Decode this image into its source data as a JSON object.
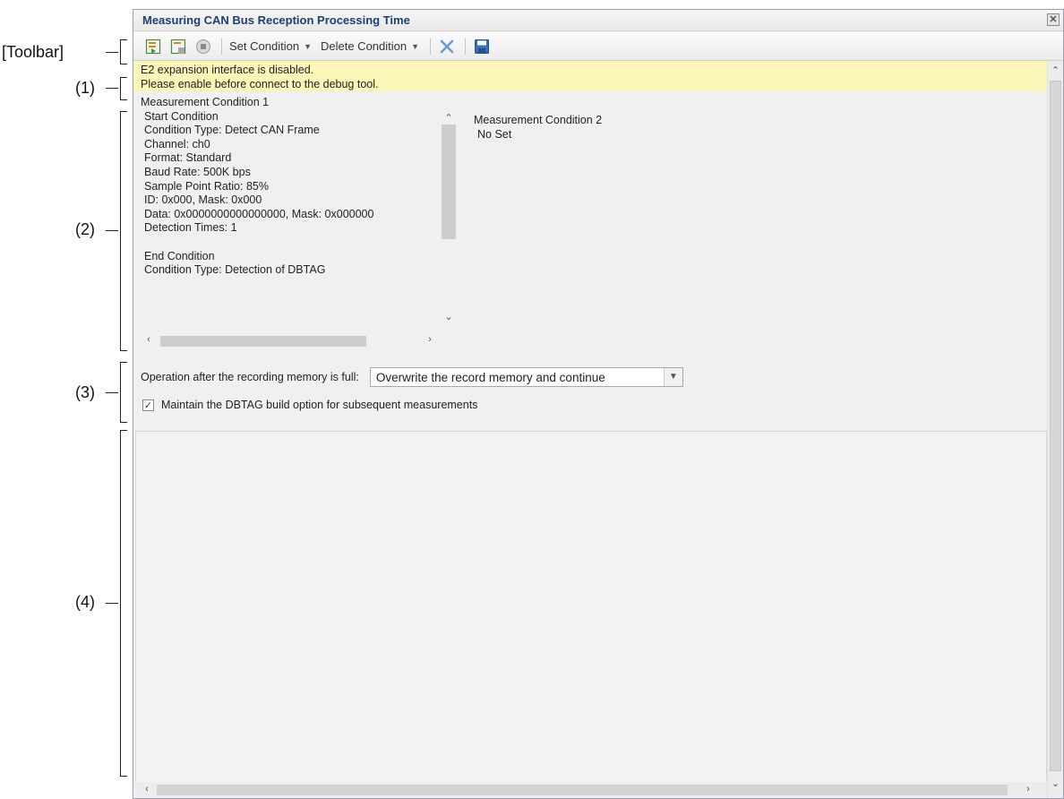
{
  "callouts": {
    "toolbar": "[Toolbar]",
    "c1": "(1)",
    "c2": "(2)",
    "c3": "(3)",
    "c4": "(4)"
  },
  "window": {
    "title": "Measuring CAN Bus Reception Processing Time",
    "close_glyph": "✕"
  },
  "toolbar": {
    "set_condition": "Set Condition",
    "delete_condition": "Delete Condition"
  },
  "warning": {
    "line1": "E2 expansion interface is disabled.",
    "line2": "Please enable before  connect to the debug tool."
  },
  "condition1": {
    "lines": [
      "Measurement Condition 1",
      "Start Condition",
      "Condition Type: Detect CAN Frame",
      "Channel: ch0",
      "Format: Standard",
      "Baud Rate: 500K bps",
      "Sample Point Ratio: 85%",
      "ID: 0x000, Mask: 0x000",
      "Data: 0x0000000000000000, Mask: 0x000000",
      "Detection Times: 1",
      "",
      "End Condition",
      "Condition Type: Detection of DBTAG"
    ]
  },
  "condition2": {
    "title": "Measurement Condition 2",
    "value": "No Set"
  },
  "options": {
    "label": "Operation after the recording memory is full:",
    "selected": "Overwrite the record memory and continue",
    "checkbox_label": "Maintain the DBTAG build option for subsequent measurements",
    "checkbox_checked": true
  }
}
